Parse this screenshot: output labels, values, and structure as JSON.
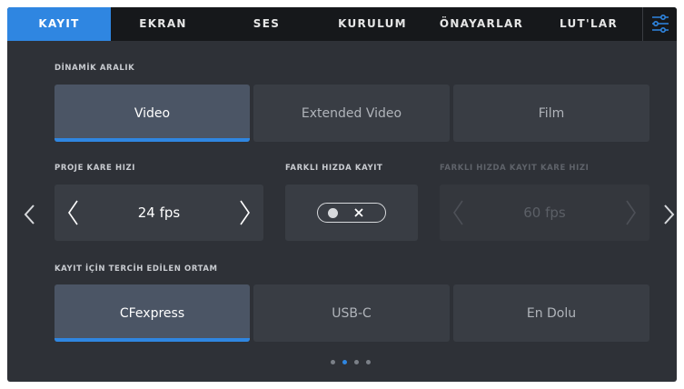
{
  "tabs": [
    {
      "label": "KAYIT",
      "active": true
    },
    {
      "label": "EKRAN",
      "active": false
    },
    {
      "label": "SES",
      "active": false
    },
    {
      "label": "KURULUM",
      "active": false
    },
    {
      "label": "ÖNAYARLAR",
      "active": false
    },
    {
      "label": "LUT'LAR",
      "active": false
    }
  ],
  "dynamic_range": {
    "label": "DİNAMİK ARALIK",
    "options": [
      "Video",
      "Extended Video",
      "Film"
    ],
    "selected": "Video"
  },
  "frame_rate": {
    "label": "PROJE KARE HIZI",
    "value": "24 fps"
  },
  "off_speed": {
    "label": "FARKLI HIZDA KAYIT",
    "enabled": false
  },
  "off_speed_rate": {
    "label": "FARKLI HIZDA KAYIT KARE HIZI",
    "value": "60 fps",
    "disabled": true
  },
  "media": {
    "label": "KAYIT İÇİN TERCİH EDİLEN ORTAM",
    "options": [
      "CFexpress",
      "USB-C",
      "En Dolu"
    ],
    "selected": "CFexpress"
  },
  "pager": {
    "count": 4,
    "current": 2
  },
  "colors": {
    "accent": "#2f86e1",
    "background": "#2e3137",
    "tabbar": "#16181b"
  }
}
